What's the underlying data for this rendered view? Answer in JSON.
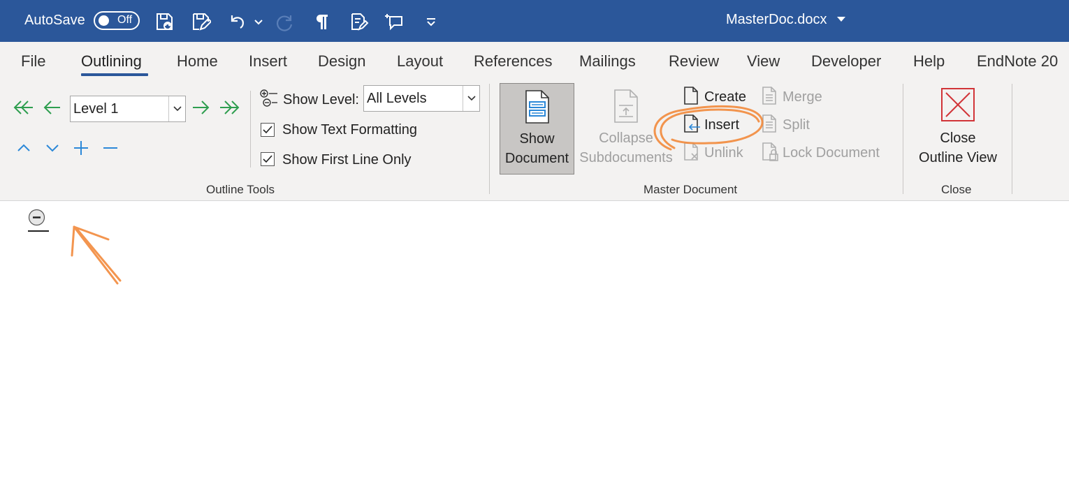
{
  "titlebar": {
    "autosave_label": "AutoSave",
    "autosave_state": "Off",
    "document_title": "MasterDoc.docx",
    "background": "#2b579a"
  },
  "ribbon": {
    "tabs": [
      "File",
      "Outlining",
      "Home",
      "Insert",
      "Design",
      "Layout",
      "References",
      "Mailings",
      "Review",
      "View",
      "Developer",
      "Help",
      "EndNote 20"
    ],
    "active_tab": "Outlining",
    "outline_tools": {
      "level_value": "Level 1",
      "show_level_label": "Show Level:",
      "show_level_value": "All Levels",
      "show_text_formatting": {
        "label": "Show Text Formatting",
        "checked": true
      },
      "show_first_line_only": {
        "label": "Show First Line Only",
        "checked": true
      },
      "group_label": "Outline Tools"
    },
    "master_document": {
      "show_document_line1": "Show",
      "show_document_line2": "Document",
      "collapse_line1": "Collapse",
      "collapse_line2": "Subdocuments",
      "create": "Create",
      "insert": "Insert",
      "unlink": "Unlink",
      "merge": "Merge",
      "split": "Split",
      "lock_document": "Lock Document",
      "group_label": "Master Document"
    },
    "close": {
      "close_line1": "Close",
      "close_line2": "Outline View",
      "group_label": "Close"
    }
  },
  "colors": {
    "accent": "#2b579a",
    "green_arrows": "#2e9e4f",
    "blue_arrows": "#2b88d8",
    "annotation": "#f28a3c",
    "close_red": "#d13438"
  }
}
